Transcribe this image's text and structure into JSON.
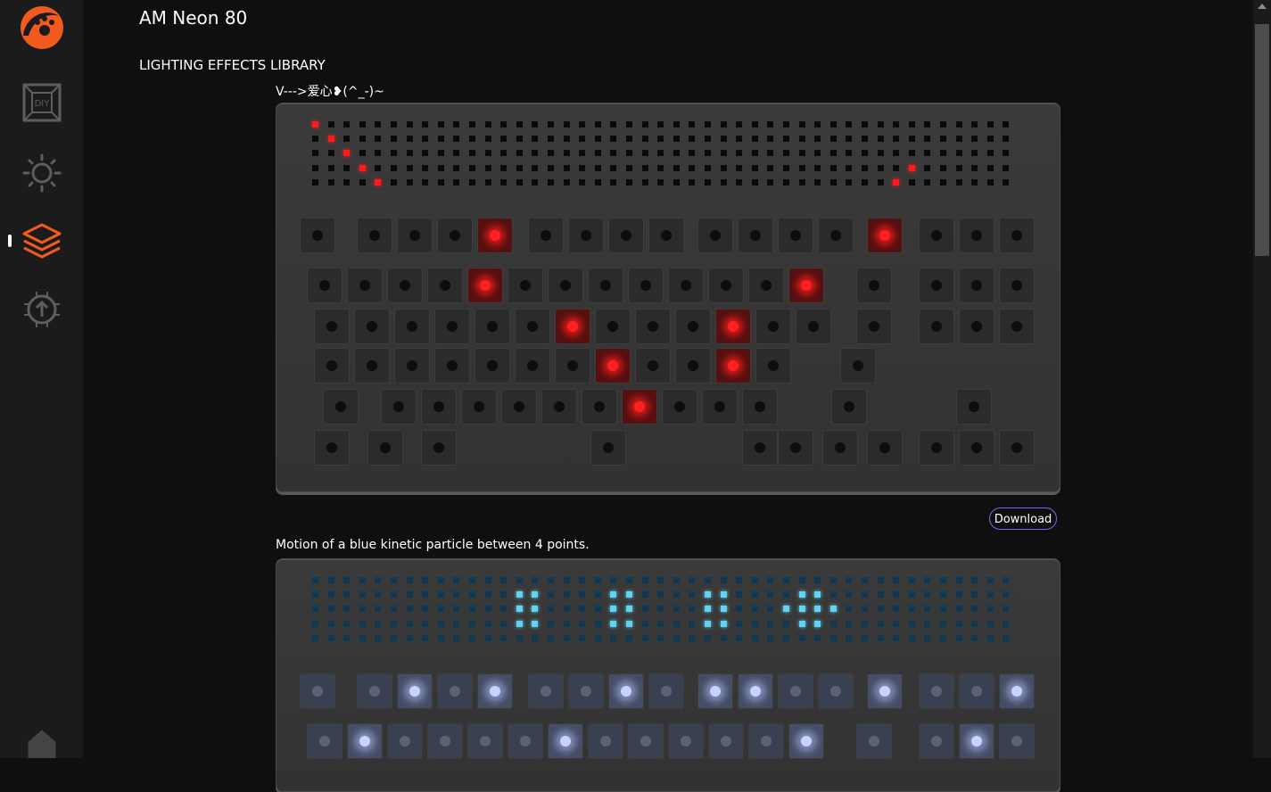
{
  "app": {
    "title": "AM Neon 80"
  },
  "sidebar": {
    "items": [
      {
        "name": "logo",
        "icon": "paw-logo-icon"
      },
      {
        "name": "diy",
        "icon": "diy-icon",
        "label": "DIY"
      },
      {
        "name": "lighting",
        "icon": "sun-icon"
      },
      {
        "name": "library",
        "icon": "layers-icon",
        "active": true
      },
      {
        "name": "upload",
        "icon": "upload-chip-icon"
      },
      {
        "name": "home",
        "icon": "home-icon"
      }
    ]
  },
  "library": {
    "heading": "LIGHTING EFFECTS LIBRARY",
    "effects": [
      {
        "title": "V--->爱心❥(^_-)~",
        "matrix_color": "red",
        "download_label": "Download"
      },
      {
        "title": "Motion of a blue kinetic particle between 4 points.",
        "matrix_color": "blue"
      }
    ]
  },
  "colors": {
    "accent": "#f25a1f",
    "download_border": "#8d5cf0",
    "red_led": "#ff2020",
    "blue_led": "#5fd2f5"
  }
}
